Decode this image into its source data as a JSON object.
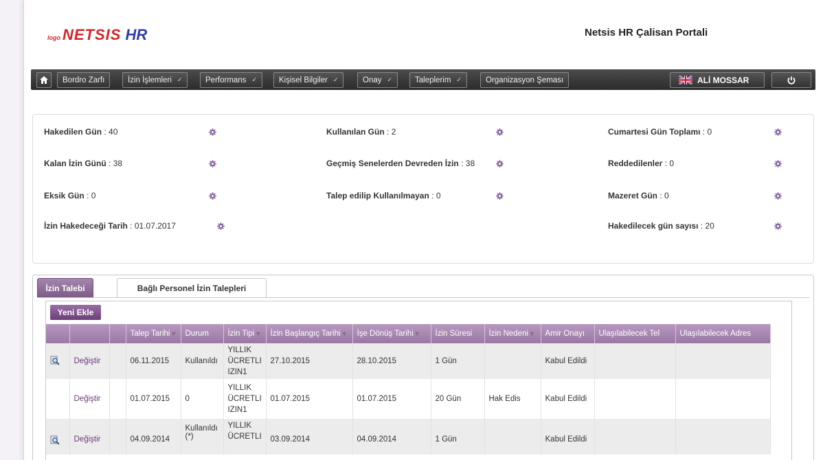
{
  "header": {
    "logo_small": "logo",
    "logo_netsis": "NETSIS",
    "logo_hr": "HR",
    "portal_title": "Netsis HR Çalisan Portali"
  },
  "nav": {
    "home_icon": "home-icon",
    "items": [
      {
        "label": "Bordro Zarfı",
        "has_menu": false
      },
      {
        "label": "İzin İşlemleri",
        "has_menu": true
      },
      {
        "label": "Performans",
        "has_menu": true
      },
      {
        "label": "Kişisel Bilgiler",
        "has_menu": true
      },
      {
        "label": "Onay",
        "has_menu": true
      },
      {
        "label": "Taleplerim",
        "has_menu": true
      },
      {
        "label": "Organizasyon Şeması",
        "has_menu": false
      }
    ],
    "user_name": "ALİ MOSSAR",
    "flag_icon": "uk-flag-icon",
    "power_icon": "power-icon"
  },
  "stats": {
    "hakedilen_gun": {
      "label": "Hakedilen Gün",
      "value": "40"
    },
    "kullanilan_gun": {
      "label": "Kullanılan Gün",
      "value": "2"
    },
    "cumartesi": {
      "label": "Cumartesi Gün Toplamı",
      "value": "0"
    },
    "kalan_izin": {
      "label": "Kalan İzin Günü",
      "value": "38"
    },
    "devreden": {
      "label": "Geçmiş Senelerden Devreden İzin",
      "value": "38"
    },
    "reddedilenler": {
      "label": "Reddedilenler",
      "value": "0"
    },
    "eksik_gun": {
      "label": "Eksik Gün",
      "value": "0"
    },
    "talep_edilip": {
      "label": "Talep edilip Kullanılmayan",
      "value": "0"
    },
    "mazeret": {
      "label": "Mazeret Gün",
      "value": "0"
    },
    "hakedecegi_tarih": {
      "label": "İzin Hakedeceği Tarih",
      "value": "01.07.2017"
    },
    "hakedilecek": {
      "label": "Hakedilecek gün sayısı",
      "value": "20"
    }
  },
  "tabs": [
    {
      "label": "İzin Talebi",
      "active": true
    },
    {
      "label": "Bağlı Personel İzin Talepleri",
      "active": false
    }
  ],
  "grid": {
    "add_button": "Yeni Ekle",
    "columns": [
      "",
      "",
      "",
      "Talep Tarihi",
      "Durum",
      "İzin Tipi",
      "İzin Başlangıç Tarihi",
      "İşe Dönüş Tarihi",
      "İzin Süresi",
      "İzin Nedeni",
      "Amir Onayı",
      "Ulaşılabilecek Tel",
      "Ulaşılabilecek Adres"
    ],
    "rows": [
      {
        "has_view": true,
        "action": "Değiştir",
        "talep": "06.11.2015",
        "durum": "Kullanıldı",
        "tipi1": "YILLIK",
        "tipi2": "ÜCRETLI",
        "tipi3": "IZIN1",
        "baslangic": "27.10.2015",
        "donus": "28.10.2015",
        "sure": "1 Gün",
        "neden": "",
        "onay": "Kabul Edildi",
        "tel": "",
        "adres": ""
      },
      {
        "has_view": false,
        "action": "Değiştir",
        "talep": "01.07.2015",
        "durum": "0",
        "tipi1": "YILLIK",
        "tipi2": "ÜCRETLI",
        "tipi3": "IZIN1",
        "baslangic": "01.07.2015",
        "donus": "01.07.2015",
        "sure": "20 Gün",
        "neden": "Hak Edis",
        "onay": "Kabul Edildi",
        "tel": "",
        "adres": ""
      },
      {
        "has_view": true,
        "action": "Değiştir",
        "talep": "04.09.2014",
        "durum": "Kullanıldı (*)",
        "tipi1": "YILLIK",
        "tipi2": "ÜCRETLI",
        "tipi3": "",
        "baslangic": "03.09.2014",
        "donus": "04.09.2014",
        "sure": "1 Gün",
        "neden": "",
        "onay": "Kabul Edildi",
        "tel": "",
        "adres": ""
      }
    ]
  }
}
